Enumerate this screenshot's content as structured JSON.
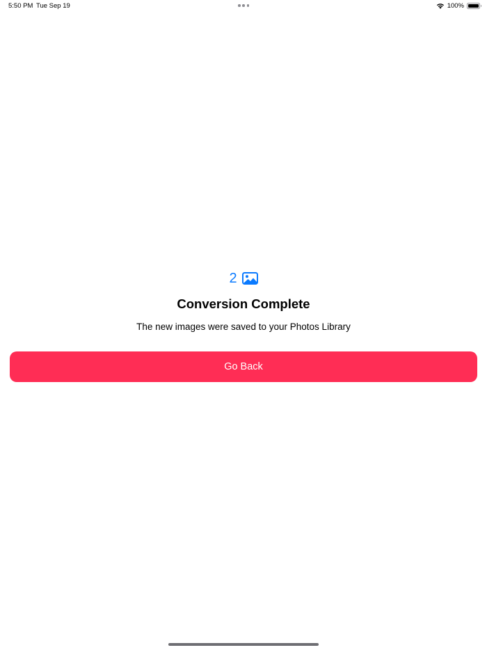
{
  "status_bar": {
    "time": "5:50 PM",
    "date": "Tue Sep 19",
    "battery_percent": "100%",
    "icons": [
      "multitasking-dots-icon",
      "wifi-icon",
      "battery-icon"
    ]
  },
  "result": {
    "image_count": "2",
    "count_icon": "photo-icon",
    "title": "Conversion Complete",
    "message": "The new images were saved to your Photos Library"
  },
  "actions": {
    "go_back_label": "Go Back"
  },
  "colors": {
    "accent_blue": "#0a7aff",
    "button_pink": "#ff2d55",
    "background": "#ffffff",
    "text": "#000000"
  }
}
